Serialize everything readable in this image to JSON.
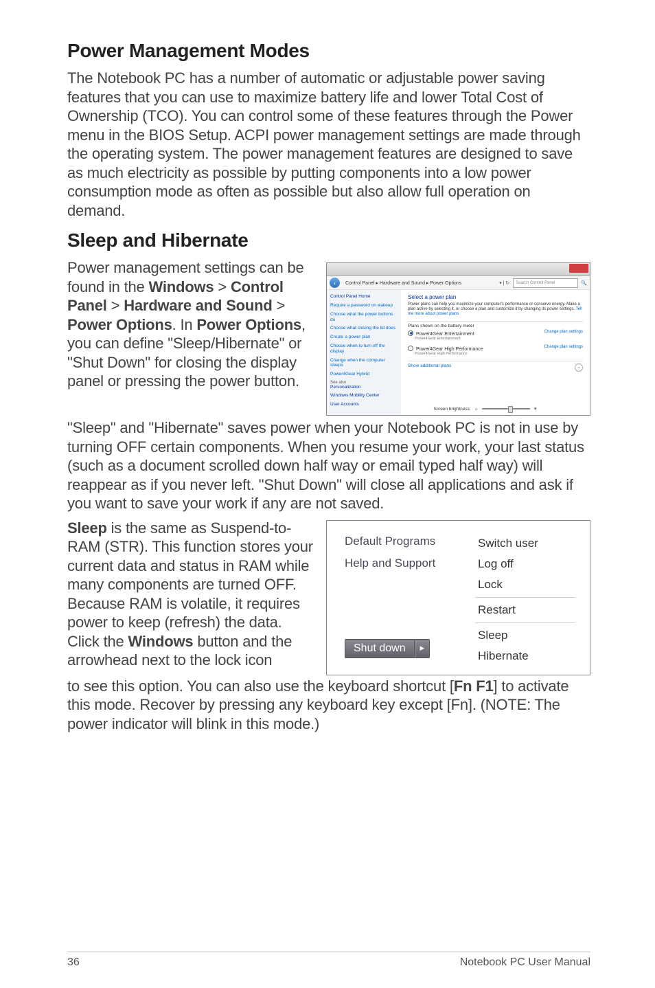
{
  "headings": {
    "h1a": "Power Management Modes",
    "h1b": "Sleep and Hibernate"
  },
  "para": {
    "p1": "The Notebook PC has a number of automatic or adjustable power saving features that you can use to maximize battery life and lower Total Cost of Ownership (TCO). You can control some of these features through the Power menu in the BIOS Setup. ACPI power management settings are made through the operating system. The power management features are designed to save as much electricity as possible by putting components into a low power consumption mode as often as possible but also allow full operation on demand.",
    "p2": "Power management settings can be found in the Windows > Control Panel > Hardware and Sound > Power Options. In Power Options, you can define \"Sleep/Hibernate\" or \"Shut Down\" for closing the display panel or pressing the power button.",
    "p3": "\"Sleep\" and \"Hibernate\" saves power when your Notebook PC is not in use by turning OFF certain components. When you resume your work, your last status (such as a document scrolled down half way or email typed half way) will reappear as if you never left. \"Shut Down\" will close all applications and ask if you want to save your work if any are not saved.",
    "p4": "Sleep is the same as Suspend-to-RAM (STR). This function stores your current data and status in RAM while many components are turned OFF. Because RAM is volatile, it requires power to keep (refresh) the data. Click the Windows button and the arrowhead next to the lock icon",
    "p5": "to see this option. You can also use the keyboard shortcut [Fn F1] to activate this mode. Recover by pressing any keyboard key except [Fn]. (NOTE: The power indicator will blink in this mode.)"
  },
  "power_options_window": {
    "breadcrumb": "Control Panel ▸ Hardware and Sound ▸ Power Options",
    "search_placeholder": "Search Control Panel",
    "sidebar_title": "Control Panel Home",
    "sidebar_links": [
      "Require a password on wakeup",
      "Choose what the power buttons do",
      "Choose what closing the lid does",
      "Create a power plan",
      "Choose when to turn off the display",
      "Change when the computer sleeps",
      "Power4Gear Hybrid"
    ],
    "see_also": "See also",
    "see_also_links": [
      "Personalization",
      "Windows Mobility Center",
      "User Accounts"
    ],
    "main_title": "Select a power plan",
    "main_desc_a": "Power plans can help you maximize your computer's performance or conserve energy. Make a plan active by selecting it, or choose a plan and customize it by changing its power settings. ",
    "main_desc_link": "Tell me more about power plans",
    "batt_section": "Plans shown on the battery meter",
    "plan1": "Power4Gear Entertainment",
    "plan1_sub": "Power4Gear Entertainment",
    "plan2": "Power4Gear High Performance",
    "plan2_sub": "Power4Gear High Performance",
    "change_link": "Change plan settings",
    "show_additional": "Show additional plans",
    "brightness_label": "Screen brightness:"
  },
  "start_menu": {
    "left_items": [
      "Default Programs",
      "Help and Support"
    ],
    "shutdown_label": "Shut down",
    "right_items_top": [
      "Switch user",
      "Log off",
      "Lock"
    ],
    "right_items_mid": [
      "Restart"
    ],
    "right_items_bot": [
      "Sleep",
      "Hibernate"
    ]
  },
  "footer": {
    "page_num": "36",
    "manual_title": "Notebook PC User Manual"
  }
}
